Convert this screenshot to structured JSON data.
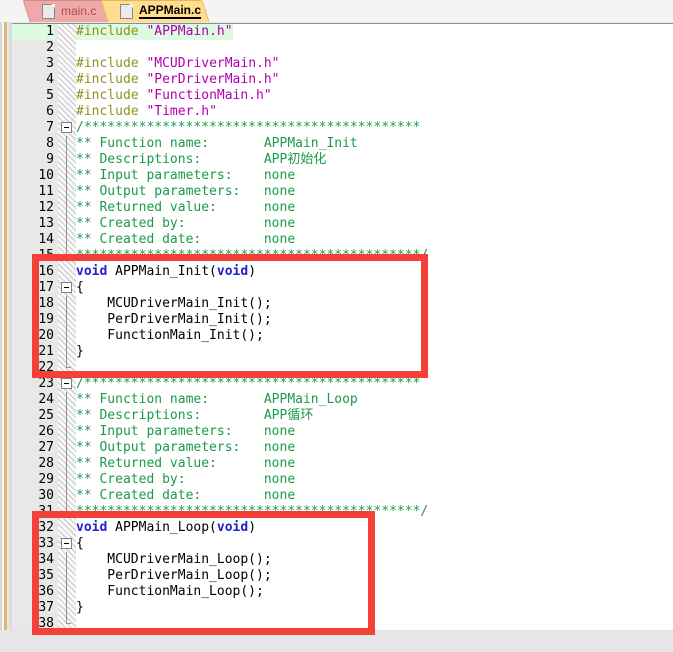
{
  "window": {
    "app": "code-editor",
    "colors": {
      "active_tab": "#ffdd8f",
      "inactive_tab": "#f0a9a9",
      "annotation": "#f5403a",
      "current_line": "#dcfbe0",
      "preprocessor": "#8f8f1f",
      "string": "#b000b0",
      "comment": "#1a9a4a",
      "keyword": "#2020d0",
      "gutter": "#e8e8e8"
    }
  },
  "tabs": [
    {
      "label": "main.c",
      "active": false,
      "icon": "document-icon"
    },
    {
      "label": "APPMain.c",
      "active": true,
      "icon": "document-icon"
    }
  ],
  "editor": {
    "current_line": 1,
    "total_lines": 38,
    "lines": [
      {
        "n": 1,
        "fold": "none",
        "tokens": [
          {
            "t": "#include ",
            "c": "pre"
          },
          {
            "t": "\"APPMain.h\"",
            "c": "str"
          }
        ]
      },
      {
        "n": 2,
        "fold": "none",
        "tokens": []
      },
      {
        "n": 3,
        "fold": "none",
        "tokens": [
          {
            "t": "#include ",
            "c": "pre"
          },
          {
            "t": "\"MCUDriverMain.h\"",
            "c": "str"
          }
        ]
      },
      {
        "n": 4,
        "fold": "none",
        "tokens": [
          {
            "t": "#include ",
            "c": "pre"
          },
          {
            "t": "\"PerDriverMain.h\"",
            "c": "str"
          }
        ]
      },
      {
        "n": 5,
        "fold": "none",
        "tokens": [
          {
            "t": "#include ",
            "c": "pre"
          },
          {
            "t": "\"FunctionMain.h\"",
            "c": "str"
          }
        ]
      },
      {
        "n": 6,
        "fold": "none",
        "tokens": [
          {
            "t": "#include ",
            "c": "pre"
          },
          {
            "t": "\"Timer.h\"",
            "c": "str"
          }
        ]
      },
      {
        "n": 7,
        "fold": "open",
        "tokens": [
          {
            "t": "/*******************************************",
            "c": "cmt"
          }
        ]
      },
      {
        "n": 8,
        "fold": "line",
        "tokens": [
          {
            "t": "** Function name:       APPMain_Init",
            "c": "cmt"
          }
        ]
      },
      {
        "n": 9,
        "fold": "line",
        "tokens": [
          {
            "t": "** Descriptions:        APP初始化",
            "c": "cmt"
          }
        ]
      },
      {
        "n": 10,
        "fold": "line",
        "tokens": [
          {
            "t": "** Input parameters:    none",
            "c": "cmt"
          }
        ]
      },
      {
        "n": 11,
        "fold": "line",
        "tokens": [
          {
            "t": "** Output parameters:   none",
            "c": "cmt"
          }
        ]
      },
      {
        "n": 12,
        "fold": "line",
        "tokens": [
          {
            "t": "** Returned value:      none",
            "c": "cmt"
          }
        ]
      },
      {
        "n": 13,
        "fold": "line",
        "tokens": [
          {
            "t": "** Created by:          none",
            "c": "cmt"
          }
        ]
      },
      {
        "n": 14,
        "fold": "line",
        "tokens": [
          {
            "t": "** Created date:        none",
            "c": "cmt"
          }
        ]
      },
      {
        "n": 15,
        "fold": "end",
        "tokens": [
          {
            "t": "********************************************/",
            "c": "cmt"
          }
        ]
      },
      {
        "n": 16,
        "fold": "none",
        "tokens": [
          {
            "t": "void ",
            "c": "kw"
          },
          {
            "t": "APPMain_Init(",
            "c": "plain"
          },
          {
            "t": "void",
            "c": "kw"
          },
          {
            "t": ")",
            "c": "plain"
          }
        ]
      },
      {
        "n": 17,
        "fold": "open",
        "tokens": [
          {
            "t": "{",
            "c": "plain"
          }
        ]
      },
      {
        "n": 18,
        "fold": "line",
        "tokens": [
          {
            "t": "    MCUDriverMain_Init();",
            "c": "plain"
          }
        ]
      },
      {
        "n": 19,
        "fold": "line",
        "tokens": [
          {
            "t": "    PerDriverMain_Init();",
            "c": "plain"
          }
        ]
      },
      {
        "n": 20,
        "fold": "line",
        "tokens": [
          {
            "t": "    FunctionMain_Init();",
            "c": "plain"
          }
        ]
      },
      {
        "n": 21,
        "fold": "line",
        "tokens": [
          {
            "t": "}",
            "c": "plain"
          }
        ]
      },
      {
        "n": 22,
        "fold": "end",
        "tokens": []
      },
      {
        "n": 23,
        "fold": "open",
        "tokens": [
          {
            "t": "/*******************************************",
            "c": "cmt"
          }
        ]
      },
      {
        "n": 24,
        "fold": "line",
        "tokens": [
          {
            "t": "** Function name:       APPMain_Loop",
            "c": "cmt"
          }
        ]
      },
      {
        "n": 25,
        "fold": "line",
        "tokens": [
          {
            "t": "** Descriptions:        APP循环",
            "c": "cmt"
          }
        ]
      },
      {
        "n": 26,
        "fold": "line",
        "tokens": [
          {
            "t": "** Input parameters:    none",
            "c": "cmt"
          }
        ]
      },
      {
        "n": 27,
        "fold": "line",
        "tokens": [
          {
            "t": "** Output parameters:   none",
            "c": "cmt"
          }
        ]
      },
      {
        "n": 28,
        "fold": "line",
        "tokens": [
          {
            "t": "** Returned value:      none",
            "c": "cmt"
          }
        ]
      },
      {
        "n": 29,
        "fold": "line",
        "tokens": [
          {
            "t": "** Created by:          none",
            "c": "cmt"
          }
        ]
      },
      {
        "n": 30,
        "fold": "line",
        "tokens": [
          {
            "t": "** Created date:        none",
            "c": "cmt"
          }
        ]
      },
      {
        "n": 31,
        "fold": "end",
        "tokens": [
          {
            "t": "********************************************/",
            "c": "cmt"
          }
        ]
      },
      {
        "n": 32,
        "fold": "none",
        "tokens": [
          {
            "t": "void ",
            "c": "kw"
          },
          {
            "t": "APPMain_Loop(",
            "c": "plain"
          },
          {
            "t": "void",
            "c": "kw"
          },
          {
            "t": ")",
            "c": "plain"
          }
        ]
      },
      {
        "n": 33,
        "fold": "open",
        "tokens": [
          {
            "t": "{",
            "c": "plain"
          }
        ]
      },
      {
        "n": 34,
        "fold": "line",
        "tokens": [
          {
            "t": "    MCUDriverMain_Loop();",
            "c": "plain"
          }
        ]
      },
      {
        "n": 35,
        "fold": "line",
        "tokens": [
          {
            "t": "    PerDriverMain_Loop();",
            "c": "plain"
          }
        ]
      },
      {
        "n": 36,
        "fold": "line",
        "tokens": [
          {
            "t": "    FunctionMain_Loop();",
            "c": "plain"
          }
        ]
      },
      {
        "n": 37,
        "fold": "line",
        "tokens": [
          {
            "t": "}",
            "c": "plain"
          }
        ]
      },
      {
        "n": 38,
        "fold": "end",
        "tokens": []
      }
    ]
  },
  "annotations": [
    {
      "name": "init-function-highlight",
      "covers_lines": "16-21"
    },
    {
      "name": "loop-function-highlight",
      "covers_lines": "32-37"
    }
  ]
}
